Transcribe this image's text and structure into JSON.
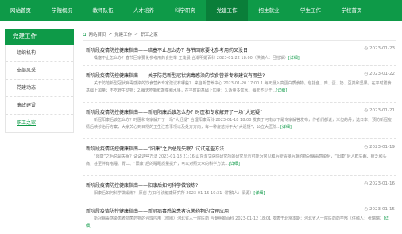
{
  "nav": {
    "items": [
      "网站首页",
      "学院概况",
      "教师队伍",
      "人才培养",
      "科学研究",
      "党建工作",
      "招生就业",
      "学生工作",
      "学校首页"
    ],
    "active_index": 5
  },
  "sidebar": {
    "title": "党建工作",
    "items": [
      "组织机构",
      "支部风采",
      "党建动态",
      "廉政建设",
      "职工之家"
    ],
    "active_index": 4
  },
  "breadcrumb": {
    "home_icon": "home-icon",
    "items": [
      "网站首页",
      "党建工作",
      "职工之家"
    ],
    "separator": ">"
  },
  "articles": [
    {
      "title": "新阶段疫情防控健康指南——暗塞不止怎么办？春节回家要化参考用药叉没日",
      "date": "2023-01-23",
      "summary": "嗓塞不止怎么办？春节回家要化参考用药食挂举 王凌晨 合潮明媚百科 2023-01-22 18:00（供稿人：吕拉辑）",
      "more": "[详细]"
    },
    {
      "title": "新阶段疫情防控健康指南——关于防范新型冠状病毒感染的饮食营养专家建议有哪些?",
      "date": "2023-01-22",
      "summary": "关于防范新型冠状病毒感染的饮食营养专家建议有哪些？ 来自新营养中心 2023-01-20 17:00 1.每天摄入高蛋白质食物。包括鱼、肉、蛋、奶、豆类和坚果，在平时膳食基础上加量；不吃野生动物；2.每天吃新鲜蔬菜和水果，在平时的基础上加量；3.适量多饮水，每天不少于...",
      "more": "[详细]"
    },
    {
      "title": "新阶段疫情防控健康指南——新冠阳康后该怎么办？时医和专家解开了一场“大迟疑”",
      "date": "2023-01-21",
      "summary": "新冠阳康后该怎么办？时医和专家解开了一场“大迟疑” 合理阳康百科 2023-01-18 18:00 发表于河南以下是专家解答发布，作者们都说，米但的丹，选日本，预防新冠疫情后续诊治行方案，大家关心到日常的卫生注意事项以及处方方向，每一种疫苗对于大“大迟疑”，公立大医院...",
      "more": "[详细]"
    },
    {
      "title": "新阶段疫情防控健康指南——“阳康”之后总是失眠？试试这些方法",
      "date": "2023-01-19",
      "summary": "“阳康”之后总是失眠？试试这些方法 2023-01-18 21:16 山东淘艾医院研究所的研究显示可能为常见和后疫情接后期的新冠病毒感染后，“阳康”后人群失眠、疲乏和头痛，甚至伴有嗜睡、胃口、“阳康”后的睡眠质量提升，可以对照大众的科学方法...",
      "more": "[详细]"
    },
    {
      "title": "新阶段疫情防控健康指南——阳康后如何科学做锻炼?",
      "date": "2023-01-16",
      "summary": "阳康后如何科学做锻炼？ 原创 力扣利 沈健康研究所 2023-01-15 19:31（供稿人：梁源）",
      "more": "[详细]"
    },
    {
      "title": "新阶段疫情防控健康指南——新冠病毒感染患者抗菌药物的合理应用",
      "date": "2023-01-15",
      "summary": "新冠病毒感染患者抗菌药物的合理应用（附图）河北省人一院医药 合潮明媚百科 2023-01-12 18:01 发表于北京本期：河北省人一院医药药学部（供稿人：张瑞瑞）",
      "more": "[详细]"
    }
  ],
  "colors": {
    "brand_green": "#0e9a48",
    "brand_green_dark": "#0a7e39"
  }
}
